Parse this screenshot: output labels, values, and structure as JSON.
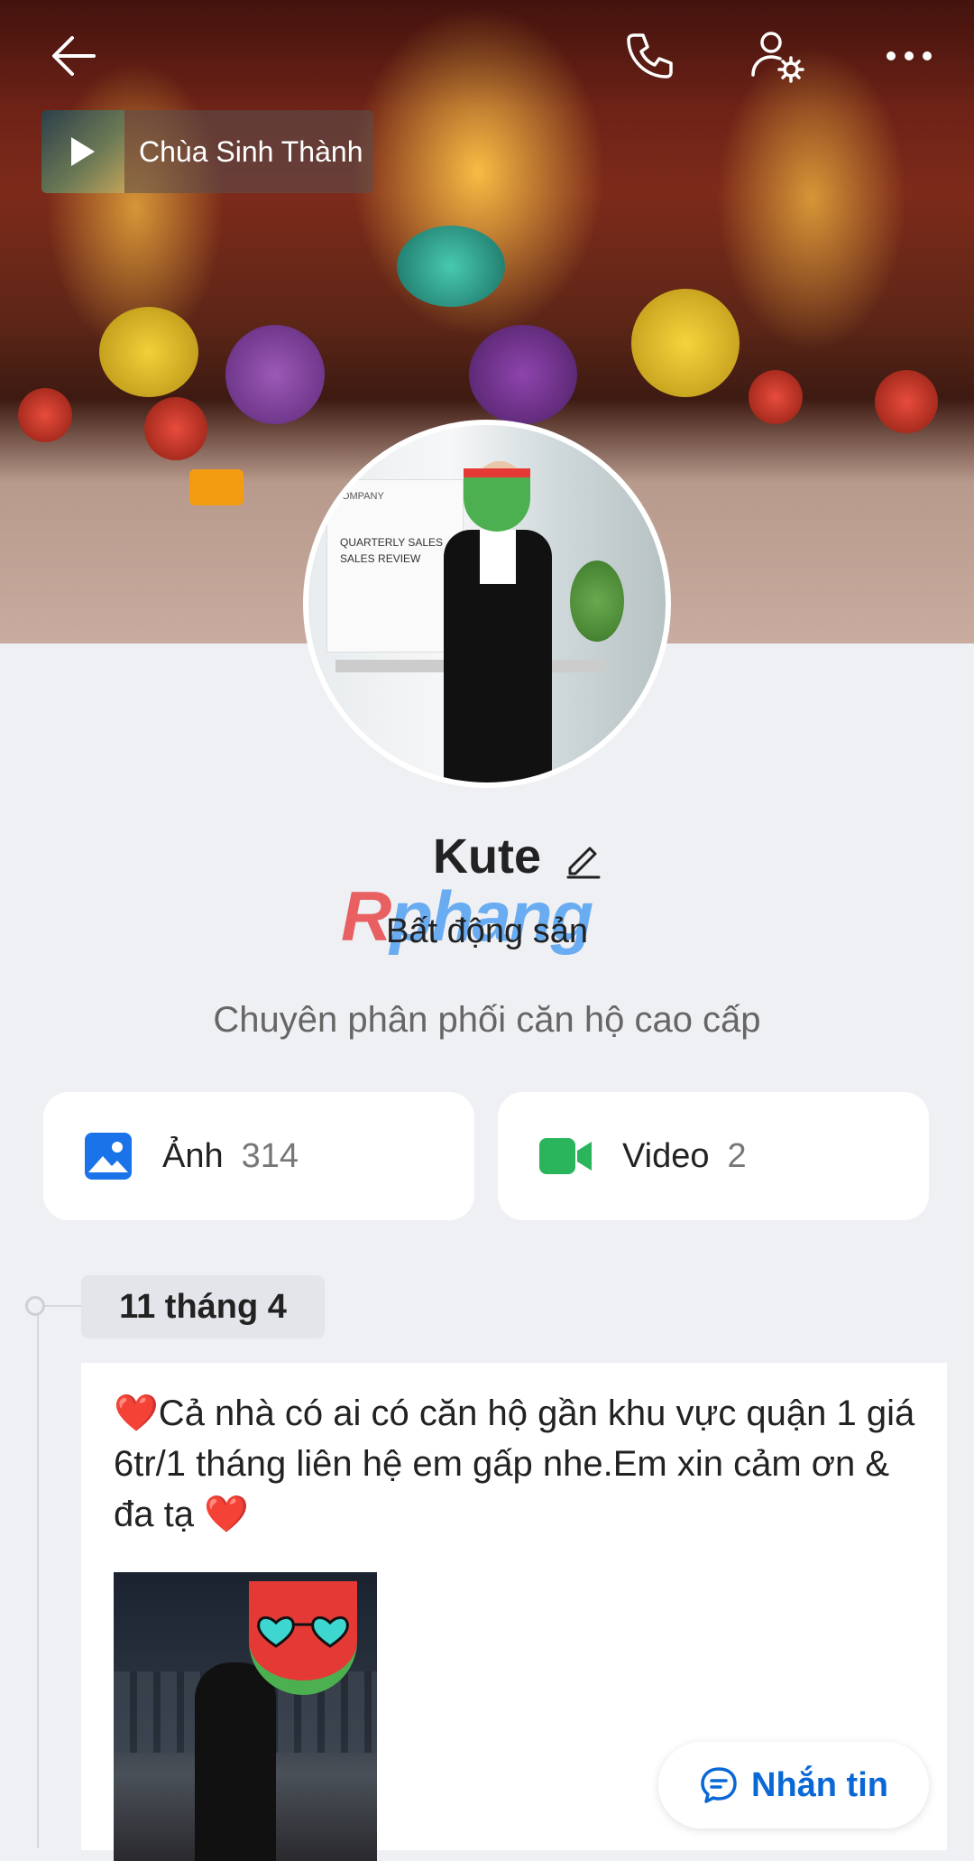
{
  "header": {
    "back_icon": "arrow-left-icon",
    "call_icon": "phone-icon",
    "settings_icon": "user-settings-icon",
    "more_icon": "more-dots-icon"
  },
  "music": {
    "title": "Chùa Sinh Thành"
  },
  "avatar_board": {
    "company": "COMPANY",
    "slide_title": "QUARTERLY SALES\nSALES REVIEW"
  },
  "profile": {
    "name": "Kute",
    "category": "Bất động sản",
    "bio": "Chuyên phân phối căn hộ cao cấp",
    "watermark": {
      "r": "R",
      "rest": "phang"
    }
  },
  "media": [
    {
      "label": "Ảnh",
      "count": "314",
      "icon": "image-icon",
      "color": "#1a73e8"
    },
    {
      "label": "Video",
      "count": "2",
      "icon": "video-camera-icon",
      "color": "#2ab55c"
    }
  ],
  "timeline": {
    "date": "11 tháng 4"
  },
  "post": {
    "text": "❤️Cả nhà có ai có căn hộ gần khu vực quận 1 giá 6tr/1 tháng liên hệ em gấp nhe.Em xin cảm ơn & đa tạ ❤️"
  },
  "message_button": {
    "label": "Nhắn tin",
    "icon": "chat-bubble-icon"
  }
}
